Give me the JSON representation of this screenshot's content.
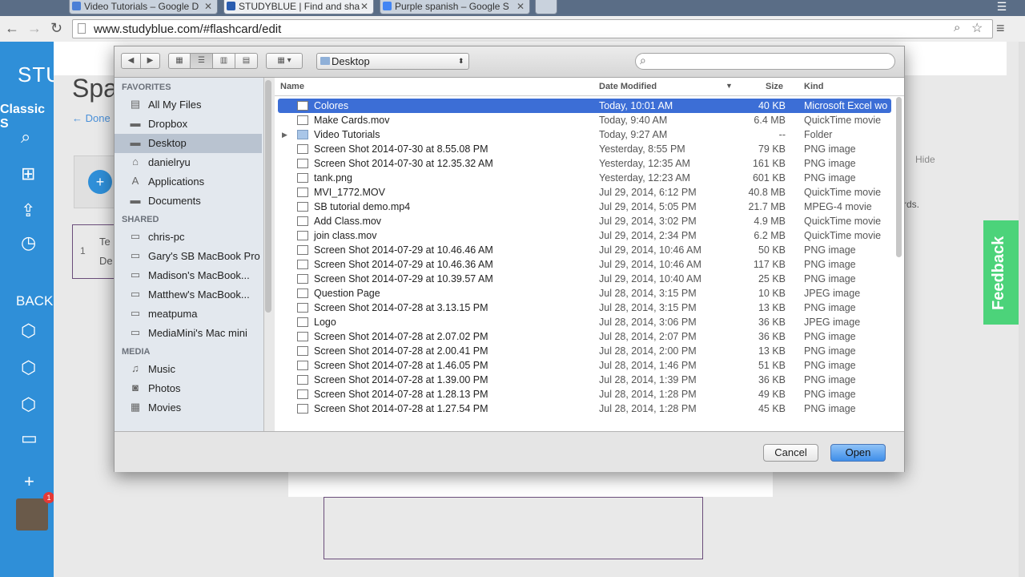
{
  "browser": {
    "tabs": [
      {
        "label": "Video Tutorials – Google D",
        "favcolor": "#4a7fd6"
      },
      {
        "label": "STUDYBLUE | Find and sha",
        "favcolor": "#2a5db0"
      },
      {
        "label": "Purple spanish – Google S",
        "favcolor": "#4285f4"
      }
    ],
    "url": "www.studyblue.com/#flashcard/edit"
  },
  "page": {
    "title_partial": "Spa",
    "done_link": "← Done",
    "classic_label": "Classic S",
    "back_label": "BACK",
    "hide_label": "Hide",
    "rds_text": "rds.",
    "card_text_1": "Te",
    "card_text_2": "De",
    "card_num": "1",
    "feedback_label": "Feedback",
    "badge_count": "1"
  },
  "dialog": {
    "location": "Desktop",
    "search_placeholder": "",
    "sidebar": {
      "favorites_header": "FAVORITES",
      "favorites": [
        {
          "label": "All My Files",
          "icon": "all-files-icon",
          "glyph": "▤"
        },
        {
          "label": "Dropbox",
          "icon": "folder-icon",
          "glyph": "▬"
        },
        {
          "label": "Desktop",
          "icon": "desktop-icon",
          "glyph": "▬",
          "selected": true
        },
        {
          "label": "danielryu",
          "icon": "home-icon",
          "glyph": "⌂"
        },
        {
          "label": "Applications",
          "icon": "applications-icon",
          "glyph": "A"
        },
        {
          "label": "Documents",
          "icon": "documents-icon",
          "glyph": "▬"
        }
      ],
      "shared_header": "SHARED",
      "shared": [
        {
          "label": "chris-pc",
          "icon": "pc-icon",
          "glyph": "▭"
        },
        {
          "label": "Gary's SB MacBook Pro",
          "icon": "laptop-icon",
          "glyph": "▭"
        },
        {
          "label": "Madison's MacBook...",
          "icon": "laptop-icon",
          "glyph": "▭"
        },
        {
          "label": "Matthew's MacBook...",
          "icon": "laptop-icon",
          "glyph": "▭"
        },
        {
          "label": "meatpuma",
          "icon": "computer-icon",
          "glyph": "▭"
        },
        {
          "label": "MediaMini's Mac mini",
          "icon": "mac-mini-icon",
          "glyph": "▭"
        }
      ],
      "media_header": "MEDIA",
      "media": [
        {
          "label": "Music",
          "icon": "music-icon",
          "glyph": "♫"
        },
        {
          "label": "Photos",
          "icon": "camera-icon",
          "glyph": "◙"
        },
        {
          "label": "Movies",
          "icon": "film-icon",
          "glyph": "▦"
        }
      ]
    },
    "columns": {
      "name": "Name",
      "date": "Date Modified",
      "size": "Size",
      "kind": "Kind"
    },
    "files": [
      {
        "name": "Colores",
        "date": "Today, 10:01 AM",
        "size": "40 KB",
        "kind": "Microsoft Excel wo",
        "selected": true
      },
      {
        "name": "Make Cards.mov",
        "date": "Today, 9:40 AM",
        "size": "6.4 MB",
        "kind": "QuickTime movie"
      },
      {
        "name": "Video Tutorials",
        "date": "Today, 9:27 AM",
        "size": "--",
        "kind": "Folder",
        "folder": true
      },
      {
        "name": "Screen Shot 2014-07-30 at 8.55.08 PM",
        "date": "Yesterday, 8:55 PM",
        "size": "79 KB",
        "kind": "PNG image"
      },
      {
        "name": "Screen Shot 2014-07-30 at 12.35.32 AM",
        "date": "Yesterday, 12:35 AM",
        "size": "161 KB",
        "kind": "PNG image"
      },
      {
        "name": "tank.png",
        "date": "Yesterday, 12:23 AM",
        "size": "601 KB",
        "kind": "PNG image"
      },
      {
        "name": "MVI_1772.MOV",
        "date": "Jul 29, 2014, 6:12 PM",
        "size": "40.8 MB",
        "kind": "QuickTime movie"
      },
      {
        "name": "SB tutorial demo.mp4",
        "date": "Jul 29, 2014, 5:05 PM",
        "size": "21.7 MB",
        "kind": "MPEG-4 movie"
      },
      {
        "name": "Add Class.mov",
        "date": "Jul 29, 2014, 3:02 PM",
        "size": "4.9 MB",
        "kind": "QuickTime movie"
      },
      {
        "name": "join class.mov",
        "date": "Jul 29, 2014, 2:34 PM",
        "size": "6.2 MB",
        "kind": "QuickTime movie"
      },
      {
        "name": "Screen Shot 2014-07-29 at 10.46.46 AM",
        "date": "Jul 29, 2014, 10:46 AM",
        "size": "50 KB",
        "kind": "PNG image"
      },
      {
        "name": "Screen Shot 2014-07-29 at 10.46.36 AM",
        "date": "Jul 29, 2014, 10:46 AM",
        "size": "117 KB",
        "kind": "PNG image"
      },
      {
        "name": "Screen Shot 2014-07-29 at 10.39.57 AM",
        "date": "Jul 29, 2014, 10:40 AM",
        "size": "25 KB",
        "kind": "PNG image"
      },
      {
        "name": "Question Page",
        "date": "Jul 28, 2014, 3:15 PM",
        "size": "10 KB",
        "kind": "JPEG image"
      },
      {
        "name": "Screen Shot 2014-07-28 at 3.13.15 PM",
        "date": "Jul 28, 2014, 3:15 PM",
        "size": "13 KB",
        "kind": "PNG image"
      },
      {
        "name": "Logo",
        "date": "Jul 28, 2014, 3:06 PM",
        "size": "36 KB",
        "kind": "JPEG image"
      },
      {
        "name": "Screen Shot 2014-07-28 at 2.07.02 PM",
        "date": "Jul 28, 2014, 2:07 PM",
        "size": "36 KB",
        "kind": "PNG image"
      },
      {
        "name": "Screen Shot 2014-07-28 at 2.00.41 PM",
        "date": "Jul 28, 2014, 2:00 PM",
        "size": "13 KB",
        "kind": "PNG image"
      },
      {
        "name": "Screen Shot 2014-07-28 at 1.46.05 PM",
        "date": "Jul 28, 2014, 1:46 PM",
        "size": "51 KB",
        "kind": "PNG image"
      },
      {
        "name": "Screen Shot 2014-07-28 at 1.39.00 PM",
        "date": "Jul 28, 2014, 1:39 PM",
        "size": "36 KB",
        "kind": "PNG image"
      },
      {
        "name": "Screen Shot 2014-07-28 at 1.28.13 PM",
        "date": "Jul 28, 2014, 1:28 PM",
        "size": "49 KB",
        "kind": "PNG image"
      },
      {
        "name": "Screen Shot 2014-07-28 at 1.27.54 PM",
        "date": "Jul 28, 2014, 1:28 PM",
        "size": "45 KB",
        "kind": "PNG image"
      }
    ],
    "cancel_label": "Cancel",
    "open_label": "Open"
  },
  "colors": {
    "selection": "#3c6ed6",
    "sidebar_blue": "#2f8fd8",
    "feedback_green": "#4cd37a"
  }
}
